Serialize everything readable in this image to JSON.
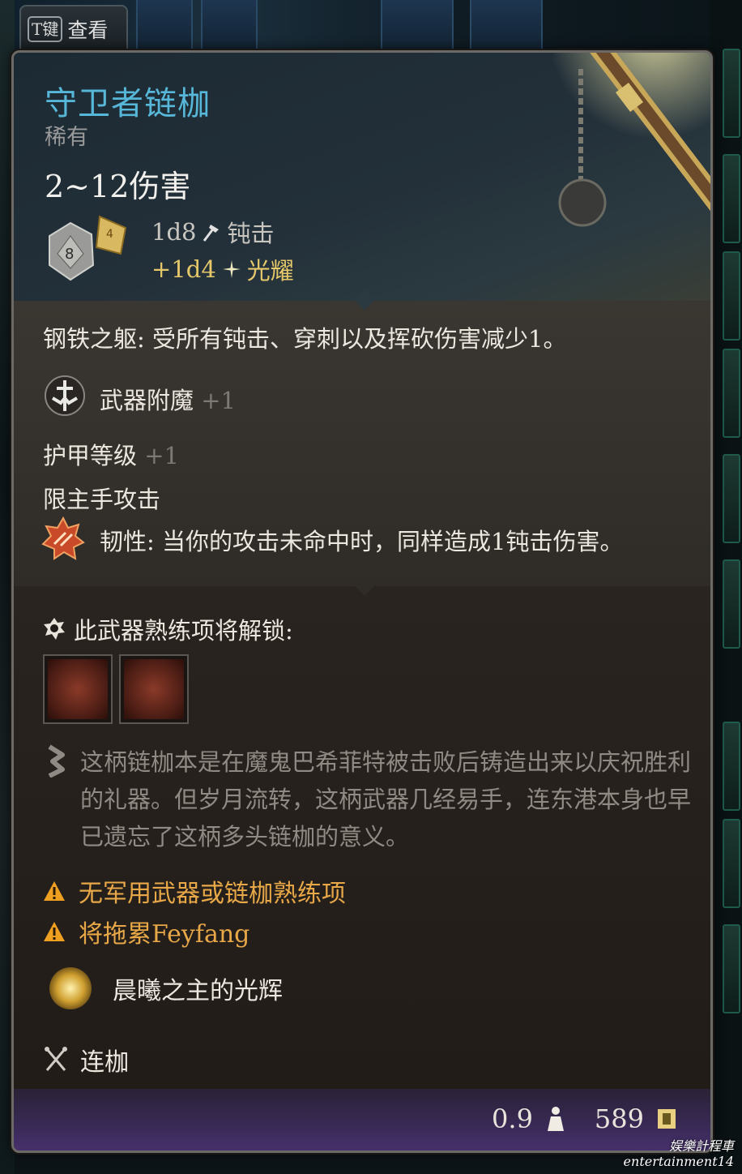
{
  "view_tab": {
    "key": "T键",
    "label": "查看"
  },
  "item": {
    "name": "守卫者链枷",
    "rarity": "稀有",
    "damage_range": "2~12伤害",
    "die_face": "8",
    "damage_lines": [
      {
        "dice": "1d8",
        "type": "钝击",
        "icon": "bludgeon-icon"
      },
      {
        "dice": "+1d4",
        "type": "光耀",
        "icon": "radiant-icon"
      }
    ]
  },
  "properties": {
    "passive": "钢铁之躯: 受所有钝击、穿刺以及挥砍伤害减少1。",
    "enchant_label": "武器附魔",
    "enchant_bonus": "+1",
    "ac_label": "护甲等级",
    "ac_bonus": "+1",
    "main_hand": "限主手攻击",
    "tenacity": "韧性: 当你的攻击未命中时，同样造成1钝击伤害。"
  },
  "proficiency": {
    "header": "此武器熟练项将解锁:",
    "actions": [
      "proficiency-action-1",
      "proficiency-action-2"
    ]
  },
  "lore": "这柄链枷本是在魔鬼巴希菲特被击败后铸造出来以庆祝胜利的礼器。但岁月流转，这柄武器几经易手，连东港本身也早已遗忘了这柄多头链枷的意义。",
  "warnings": [
    "无军用武器或链枷熟练项",
    "将拖累Feyfang"
  ],
  "radiance_label": "晨曦之主的光辉",
  "weapon_type": "连枷",
  "footer": {
    "weight": "0.9",
    "value": "589"
  },
  "watermark": {
    "line1": "娱樂計程車",
    "line2": "entertainment14"
  },
  "colors": {
    "name": "#57b7d8",
    "radiant": "#e6c86a",
    "warning": "#e8a848",
    "footer": "#4a3270"
  }
}
